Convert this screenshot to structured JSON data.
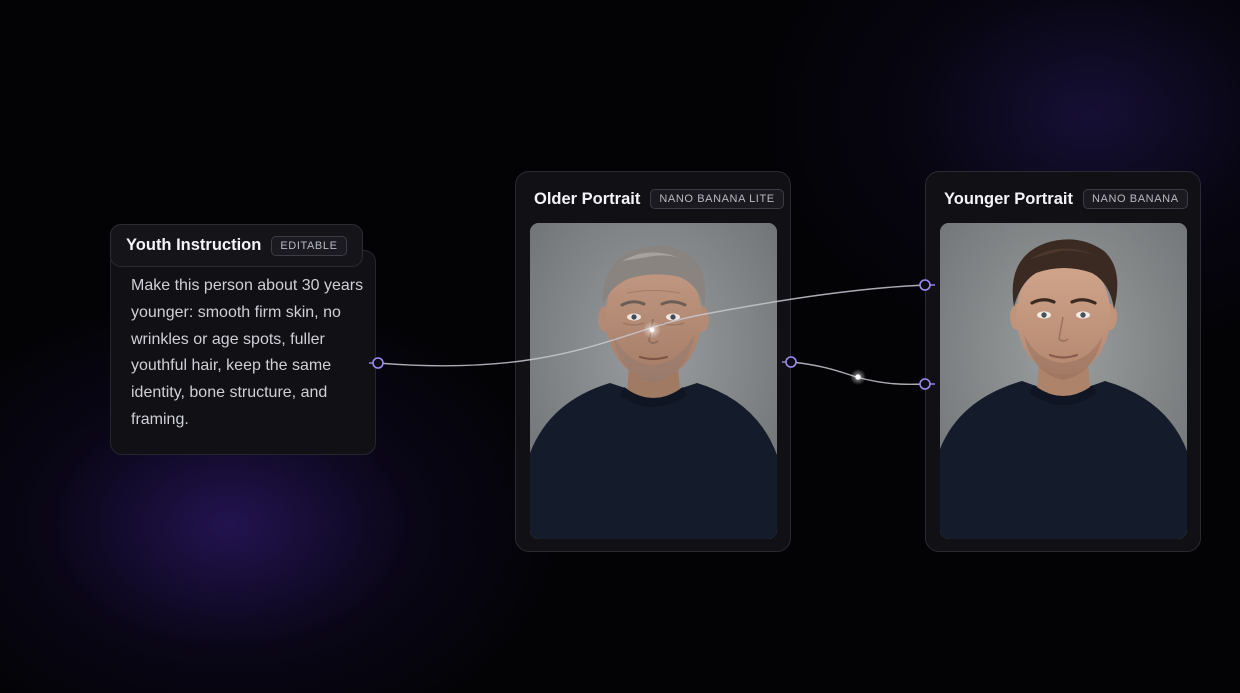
{
  "nodes": {
    "prompt": {
      "title": "Youth Instruction",
      "badge": "EDITABLE",
      "text": "Make this person about 30 years younger: smooth firm skin, no wrinkles or age spots, fuller youthful hair, keep the same identity, bone structure, and framing."
    },
    "older": {
      "title": "Older Portrait",
      "badge": "NANO BANANA LITE",
      "image": "portrait-older-man"
    },
    "younger": {
      "title": "Younger Portrait",
      "badge": "NANO BANANA",
      "image": "portrait-younger-man"
    }
  },
  "colors": {
    "background": "#030306",
    "node_background": "#101015",
    "node_border": "#2a2a32",
    "port_accent": "#9d8cf0",
    "edge": "#c8c8d2"
  }
}
